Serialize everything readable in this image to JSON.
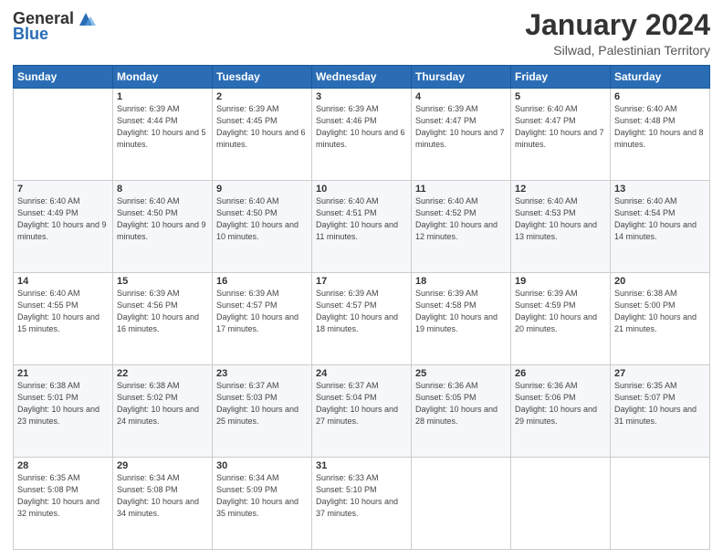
{
  "header": {
    "logo_general": "General",
    "logo_blue": "Blue",
    "main_title": "January 2024",
    "subtitle": "Silwad, Palestinian Territory"
  },
  "weekdays": [
    "Sunday",
    "Monday",
    "Tuesday",
    "Wednesday",
    "Thursday",
    "Friday",
    "Saturday"
  ],
  "weeks": [
    [
      {
        "day": "",
        "sunrise": "",
        "sunset": "",
        "daylight": ""
      },
      {
        "day": "1",
        "sunrise": "Sunrise: 6:39 AM",
        "sunset": "Sunset: 4:44 PM",
        "daylight": "Daylight: 10 hours and 5 minutes."
      },
      {
        "day": "2",
        "sunrise": "Sunrise: 6:39 AM",
        "sunset": "Sunset: 4:45 PM",
        "daylight": "Daylight: 10 hours and 6 minutes."
      },
      {
        "day": "3",
        "sunrise": "Sunrise: 6:39 AM",
        "sunset": "Sunset: 4:46 PM",
        "daylight": "Daylight: 10 hours and 6 minutes."
      },
      {
        "day": "4",
        "sunrise": "Sunrise: 6:39 AM",
        "sunset": "Sunset: 4:47 PM",
        "daylight": "Daylight: 10 hours and 7 minutes."
      },
      {
        "day": "5",
        "sunrise": "Sunrise: 6:40 AM",
        "sunset": "Sunset: 4:47 PM",
        "daylight": "Daylight: 10 hours and 7 minutes."
      },
      {
        "day": "6",
        "sunrise": "Sunrise: 6:40 AM",
        "sunset": "Sunset: 4:48 PM",
        "daylight": "Daylight: 10 hours and 8 minutes."
      }
    ],
    [
      {
        "day": "7",
        "sunrise": "Sunrise: 6:40 AM",
        "sunset": "Sunset: 4:49 PM",
        "daylight": "Daylight: 10 hours and 9 minutes."
      },
      {
        "day": "8",
        "sunrise": "Sunrise: 6:40 AM",
        "sunset": "Sunset: 4:50 PM",
        "daylight": "Daylight: 10 hours and 9 minutes."
      },
      {
        "day": "9",
        "sunrise": "Sunrise: 6:40 AM",
        "sunset": "Sunset: 4:50 PM",
        "daylight": "Daylight: 10 hours and 10 minutes."
      },
      {
        "day": "10",
        "sunrise": "Sunrise: 6:40 AM",
        "sunset": "Sunset: 4:51 PM",
        "daylight": "Daylight: 10 hours and 11 minutes."
      },
      {
        "day": "11",
        "sunrise": "Sunrise: 6:40 AM",
        "sunset": "Sunset: 4:52 PM",
        "daylight": "Daylight: 10 hours and 12 minutes."
      },
      {
        "day": "12",
        "sunrise": "Sunrise: 6:40 AM",
        "sunset": "Sunset: 4:53 PM",
        "daylight": "Daylight: 10 hours and 13 minutes."
      },
      {
        "day": "13",
        "sunrise": "Sunrise: 6:40 AM",
        "sunset": "Sunset: 4:54 PM",
        "daylight": "Daylight: 10 hours and 14 minutes."
      }
    ],
    [
      {
        "day": "14",
        "sunrise": "Sunrise: 6:40 AM",
        "sunset": "Sunset: 4:55 PM",
        "daylight": "Daylight: 10 hours and 15 minutes."
      },
      {
        "day": "15",
        "sunrise": "Sunrise: 6:39 AM",
        "sunset": "Sunset: 4:56 PM",
        "daylight": "Daylight: 10 hours and 16 minutes."
      },
      {
        "day": "16",
        "sunrise": "Sunrise: 6:39 AM",
        "sunset": "Sunset: 4:57 PM",
        "daylight": "Daylight: 10 hours and 17 minutes."
      },
      {
        "day": "17",
        "sunrise": "Sunrise: 6:39 AM",
        "sunset": "Sunset: 4:57 PM",
        "daylight": "Daylight: 10 hours and 18 minutes."
      },
      {
        "day": "18",
        "sunrise": "Sunrise: 6:39 AM",
        "sunset": "Sunset: 4:58 PM",
        "daylight": "Daylight: 10 hours and 19 minutes."
      },
      {
        "day": "19",
        "sunrise": "Sunrise: 6:39 AM",
        "sunset": "Sunset: 4:59 PM",
        "daylight": "Daylight: 10 hours and 20 minutes."
      },
      {
        "day": "20",
        "sunrise": "Sunrise: 6:38 AM",
        "sunset": "Sunset: 5:00 PM",
        "daylight": "Daylight: 10 hours and 21 minutes."
      }
    ],
    [
      {
        "day": "21",
        "sunrise": "Sunrise: 6:38 AM",
        "sunset": "Sunset: 5:01 PM",
        "daylight": "Daylight: 10 hours and 23 minutes."
      },
      {
        "day": "22",
        "sunrise": "Sunrise: 6:38 AM",
        "sunset": "Sunset: 5:02 PM",
        "daylight": "Daylight: 10 hours and 24 minutes."
      },
      {
        "day": "23",
        "sunrise": "Sunrise: 6:37 AM",
        "sunset": "Sunset: 5:03 PM",
        "daylight": "Daylight: 10 hours and 25 minutes."
      },
      {
        "day": "24",
        "sunrise": "Sunrise: 6:37 AM",
        "sunset": "Sunset: 5:04 PM",
        "daylight": "Daylight: 10 hours and 27 minutes."
      },
      {
        "day": "25",
        "sunrise": "Sunrise: 6:36 AM",
        "sunset": "Sunset: 5:05 PM",
        "daylight": "Daylight: 10 hours and 28 minutes."
      },
      {
        "day": "26",
        "sunrise": "Sunrise: 6:36 AM",
        "sunset": "Sunset: 5:06 PM",
        "daylight": "Daylight: 10 hours and 29 minutes."
      },
      {
        "day": "27",
        "sunrise": "Sunrise: 6:35 AM",
        "sunset": "Sunset: 5:07 PM",
        "daylight": "Daylight: 10 hours and 31 minutes."
      }
    ],
    [
      {
        "day": "28",
        "sunrise": "Sunrise: 6:35 AM",
        "sunset": "Sunset: 5:08 PM",
        "daylight": "Daylight: 10 hours and 32 minutes."
      },
      {
        "day": "29",
        "sunrise": "Sunrise: 6:34 AM",
        "sunset": "Sunset: 5:08 PM",
        "daylight": "Daylight: 10 hours and 34 minutes."
      },
      {
        "day": "30",
        "sunrise": "Sunrise: 6:34 AM",
        "sunset": "Sunset: 5:09 PM",
        "daylight": "Daylight: 10 hours and 35 minutes."
      },
      {
        "day": "31",
        "sunrise": "Sunrise: 6:33 AM",
        "sunset": "Sunset: 5:10 PM",
        "daylight": "Daylight: 10 hours and 37 minutes."
      },
      {
        "day": "",
        "sunrise": "",
        "sunset": "",
        "daylight": ""
      },
      {
        "day": "",
        "sunrise": "",
        "sunset": "",
        "daylight": ""
      },
      {
        "day": "",
        "sunrise": "",
        "sunset": "",
        "daylight": ""
      }
    ]
  ]
}
